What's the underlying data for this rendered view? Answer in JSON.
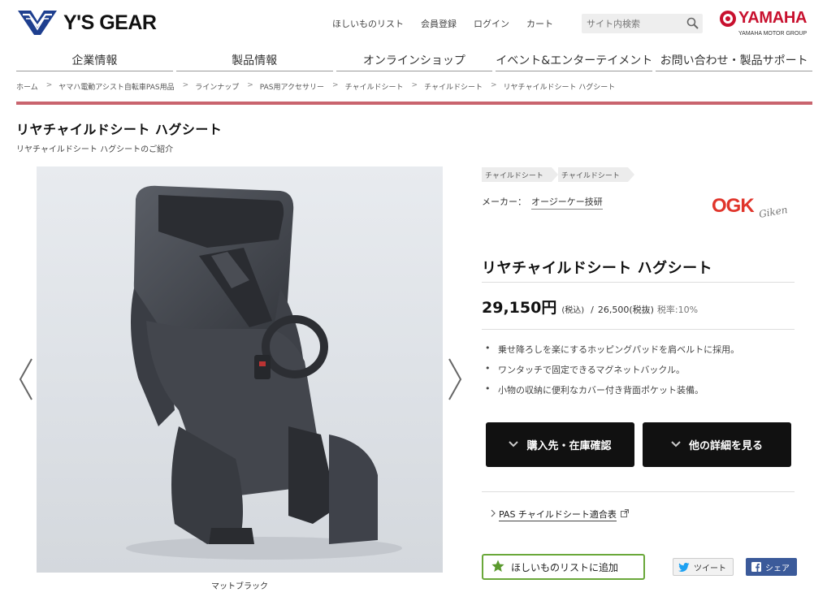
{
  "header": {
    "logo_text": "Y'S GEAR",
    "utility_links": [
      "ほしいものリスト",
      "会員登録",
      "ログイン",
      "カート"
    ],
    "search": {
      "placeholder": "サイト内検索"
    },
    "brand": {
      "name": "YAMAHA",
      "tagline": "YAMAHA MOTOR GROUP"
    }
  },
  "main_nav": [
    "企業情報",
    "製品情報",
    "オンラインショップ",
    "イベント&エンターテイメント",
    "お問い合わせ・製品サポート"
  ],
  "breadcrumb": [
    "ホーム",
    "ヤマハ電動アシスト自転車PAS用品",
    "ラインナップ",
    "PAS用アクセサリー",
    "チャイルドシート",
    "チャイルドシート",
    "リヤチャイルドシート ハグシート"
  ],
  "page": {
    "title": "リヤチャイルドシート ハグシート",
    "subtitle": "リヤチャイルドシート ハグシートのご紹介"
  },
  "gallery": {
    "caption": "マットブラック"
  },
  "product": {
    "tags": [
      "チャイルドシート",
      "チャイルドシート"
    ],
    "maker_label": "メーカー：",
    "maker_name": "オージーケー技研",
    "maker_logo": {
      "primary": "OGK",
      "secondary": "Giken"
    },
    "name": "リヤチャイルドシート ハグシート",
    "price_main": "29,150円",
    "price_taxin_label": "(税込)",
    "price_slash": "/",
    "price_excl": "26,500(税抜)",
    "price_tax_rate": "税率:10%",
    "features": [
      "乗せ降ろしを楽にするホッピングパッドを肩ベルトに採用。",
      "ワンタッチで固定できるマグネットバックル。",
      "小物の収納に便利なカバー付き背面ポケット装備。"
    ],
    "buttons": {
      "stock": "購入先・在庫確認",
      "details": "他の詳細を見る"
    },
    "compat_link": "PAS チャイルドシート適合表",
    "wishlist_button": "ほしいものリストに追加",
    "share": {
      "twitter": "ツイート",
      "facebook": "シェア"
    }
  },
  "colors": {
    "accent_bar": "#c9646e",
    "brand_red": "#c8102e",
    "wishlist_green": "#6aa83a",
    "facebook_blue": "#3b5a9a"
  }
}
